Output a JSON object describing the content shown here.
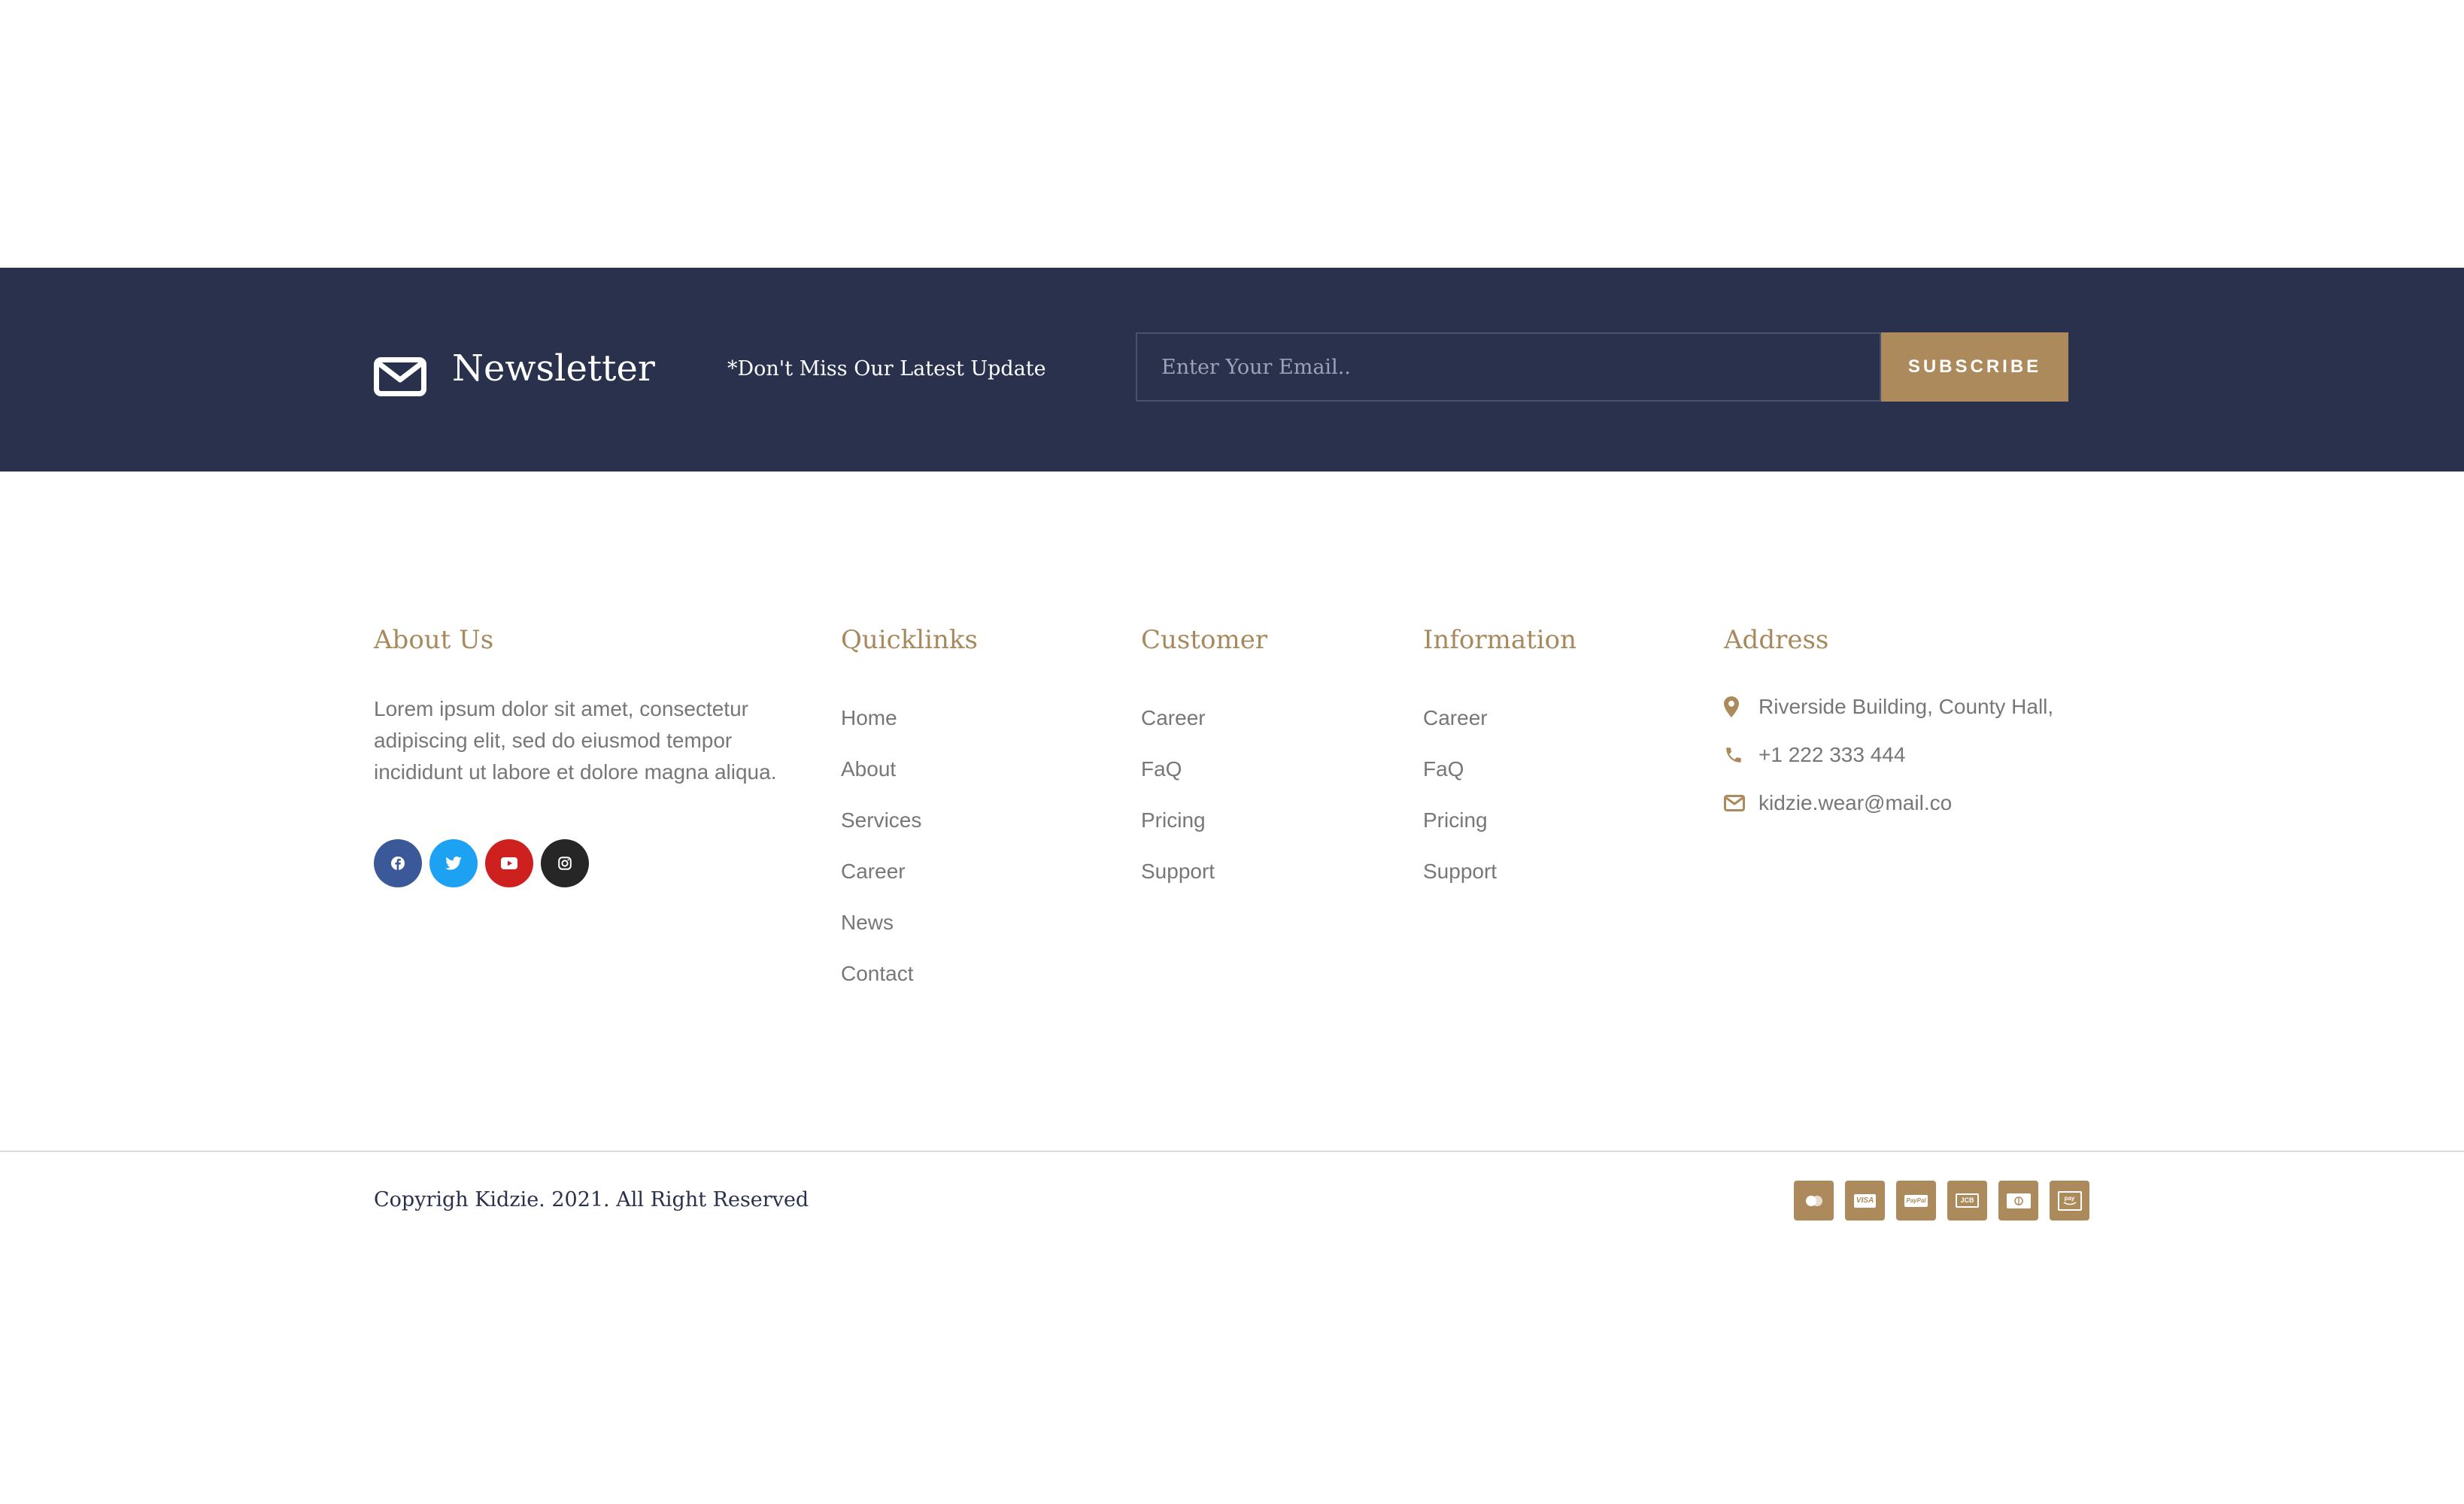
{
  "colors": {
    "navy": "#29314d",
    "gold": "#ad8a5c",
    "heading_gold": "#a8895d",
    "body_text": "#777777",
    "facebook": "#3b5998",
    "twitter": "#1da1f2",
    "youtube": "#cd201f",
    "instagram": "#262626"
  },
  "newsletter": {
    "icon": "envelope-icon",
    "title": "Newsletter",
    "tagline": "*Don't Miss Our Latest Update",
    "email_placeholder": "Enter Your Email..",
    "email_value": "",
    "subscribe_label": "SUBSCRIBE"
  },
  "about": {
    "heading": "About Us",
    "text": "Lorem ipsum dolor sit amet, consectetur adipiscing elit, sed do eiusmod tempor incididunt ut labore et dolore magna aliqua.",
    "social": [
      {
        "name": "facebook",
        "icon": "facebook-icon"
      },
      {
        "name": "twitter",
        "icon": "twitter-icon"
      },
      {
        "name": "youtube",
        "icon": "youtube-icon"
      },
      {
        "name": "instagram",
        "icon": "instagram-icon"
      }
    ]
  },
  "quicklinks": {
    "heading": "Quicklinks",
    "items": [
      "Home",
      "About",
      "Services",
      "Career",
      "News",
      "Contact"
    ]
  },
  "customer": {
    "heading": "Customer",
    "items": [
      "Career",
      "FaQ",
      "Pricing",
      "Support"
    ]
  },
  "information": {
    "heading": "Information",
    "items": [
      "Career",
      "FaQ",
      "Pricing",
      "Support"
    ]
  },
  "address": {
    "heading": "Address",
    "location": "Riverside Building, County Hall,",
    "phone": "+1 222 333 444",
    "email": "kidzie.wear@mail.co",
    "icons": [
      "map-pin-icon",
      "phone-icon",
      "envelope-outline-icon"
    ]
  },
  "footer": {
    "copyright": "Copyrigh Kidzie. 2021. All Right Reserved",
    "payment_icons": [
      "mastercard-icon",
      "visa-icon",
      "paypal-icon",
      "jcb-icon",
      "diners-club-icon",
      "amazon-pay-icon"
    ]
  }
}
